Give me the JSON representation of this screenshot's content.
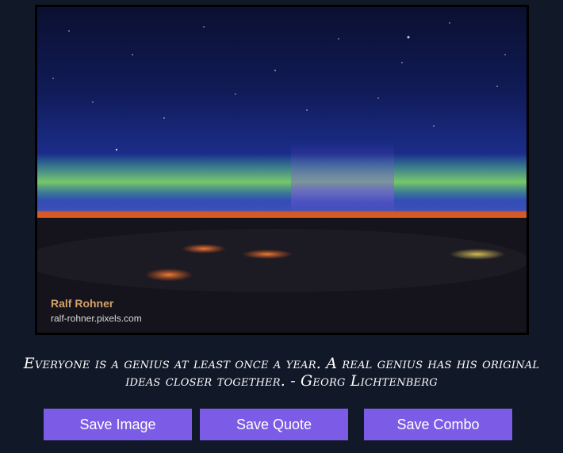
{
  "image": {
    "description_icon": "aurora-photo",
    "credit_name": "Ralf Rohner",
    "credit_url": "ralf-rohner.pixels.com"
  },
  "quote": {
    "text": "Everyone is a genius at least once a year. A real genius has his original ideas closer together. - Georg Lichtenberg"
  },
  "buttons": {
    "save_image": "Save Image",
    "save_quote": "Save Quote",
    "save_combo": "Save Combo"
  },
  "colors": {
    "background": "#111827",
    "button": "#7c5ce6",
    "text": "#ffffff"
  }
}
